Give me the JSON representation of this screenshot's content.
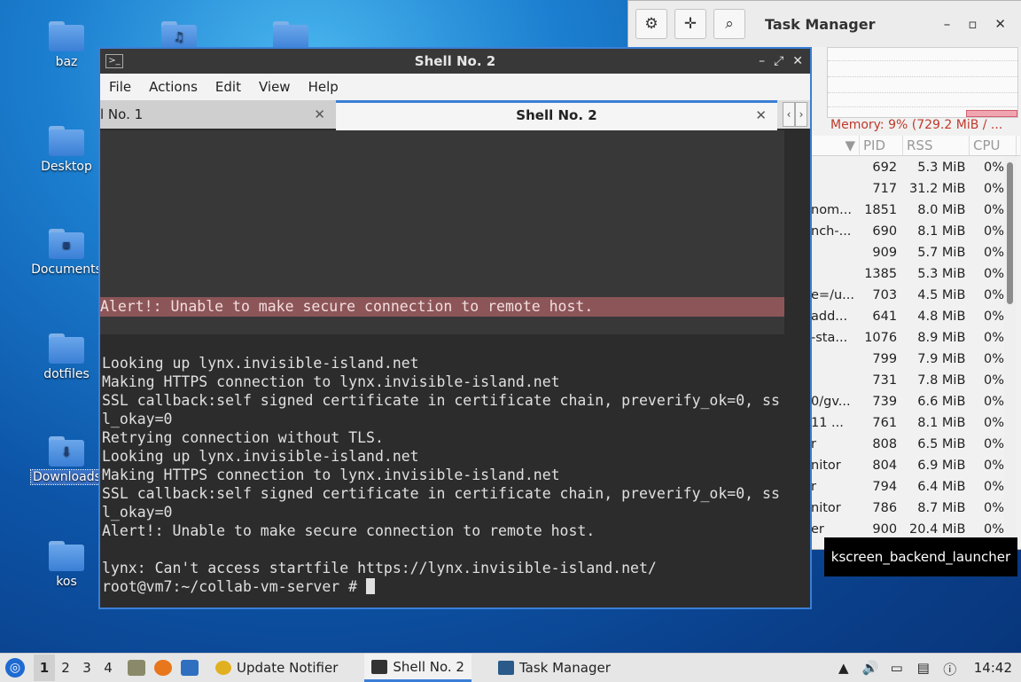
{
  "desktop": {
    "icons": [
      {
        "label": "baz"
      },
      {
        "label": "Desktop"
      },
      {
        "label": "Documents"
      },
      {
        "label": "dotfiles"
      },
      {
        "label": "Downloads"
      },
      {
        "label": "kos"
      }
    ]
  },
  "task_manager": {
    "title": "Task Manager",
    "memory": "Memory: 9% (729.2 MiB / ...",
    "columns": [
      "PID",
      "RSS",
      "CPU"
    ],
    "rows": [
      {
        "name": "",
        "pid": "692",
        "rss": "5.3 MiB",
        "cpu": "0%"
      },
      {
        "name": "",
        "pid": "717",
        "rss": "31.2 MiB",
        "cpu": "0%"
      },
      {
        "name": "nom...",
        "pid": "1851",
        "rss": "8.0 MiB",
        "cpu": "0%"
      },
      {
        "name": "nch-...",
        "pid": "690",
        "rss": "8.1 MiB",
        "cpu": "0%"
      },
      {
        "name": "",
        "pid": "909",
        "rss": "5.7 MiB",
        "cpu": "0%"
      },
      {
        "name": "",
        "pid": "1385",
        "rss": "5.3 MiB",
        "cpu": "0%"
      },
      {
        "name": "e=/u...",
        "pid": "703",
        "rss": "4.5 MiB",
        "cpu": "0%"
      },
      {
        "name": "add...",
        "pid": "641",
        "rss": "4.8 MiB",
        "cpu": "0%"
      },
      {
        "name": "-sta...",
        "pid": "1076",
        "rss": "8.9 MiB",
        "cpu": "0%"
      },
      {
        "name": "",
        "pid": "799",
        "rss": "7.9 MiB",
        "cpu": "0%"
      },
      {
        "name": "",
        "pid": "731",
        "rss": "7.8 MiB",
        "cpu": "0%"
      },
      {
        "name": "0/gv...",
        "pid": "739",
        "rss": "6.6 MiB",
        "cpu": "0%"
      },
      {
        "name": "11 ...",
        "pid": "761",
        "rss": "8.1 MiB",
        "cpu": "0%"
      },
      {
        "name": "r",
        "pid": "808",
        "rss": "6.5 MiB",
        "cpu": "0%"
      },
      {
        "name": "nitor",
        "pid": "804",
        "rss": "6.9 MiB",
        "cpu": "0%"
      },
      {
        "name": "r",
        "pid": "794",
        "rss": "6.4 MiB",
        "cpu": "0%"
      },
      {
        "name": "nitor",
        "pid": "786",
        "rss": "8.7 MiB",
        "cpu": "0%"
      },
      {
        "name": "er",
        "pid": "900",
        "rss": "20.4 MiB",
        "cpu": "0%"
      }
    ],
    "tooltip": "kscreen_backend_launcher"
  },
  "shell": {
    "title": "Shell No. 2",
    "menu": [
      "File",
      "Actions",
      "Edit",
      "View",
      "Help"
    ],
    "tabs": [
      "l No. 1",
      "Shell No. 2"
    ],
    "alert_bar": "Alert!: Unable to make secure connection to remote host.",
    "output": [
      "Looking up lynx.invisible-island.net",
      "Making HTTPS connection to lynx.invisible-island.net",
      "SSL callback:self signed certificate in certificate chain, preverify_ok=0, ss",
      "l_okay=0",
      "Retrying connection without TLS.",
      "Looking up lynx.invisible-island.net",
      "Making HTTPS connection to lynx.invisible-island.net",
      "SSL callback:self signed certificate in certificate chain, preverify_ok=0, ss",
      "l_okay=0",
      "Alert!: Unable to make secure connection to remote host.",
      "",
      "lynx: Can't access startfile https://lynx.invisible-island.net/",
      "root@vm7:~/collab-vm-server # "
    ]
  },
  "taskbar": {
    "workspaces": [
      "1",
      "2",
      "3",
      "4"
    ],
    "tasks": [
      "Update Notifier",
      "Shell No. 2",
      "Task Manager"
    ],
    "clock": "14:42"
  }
}
